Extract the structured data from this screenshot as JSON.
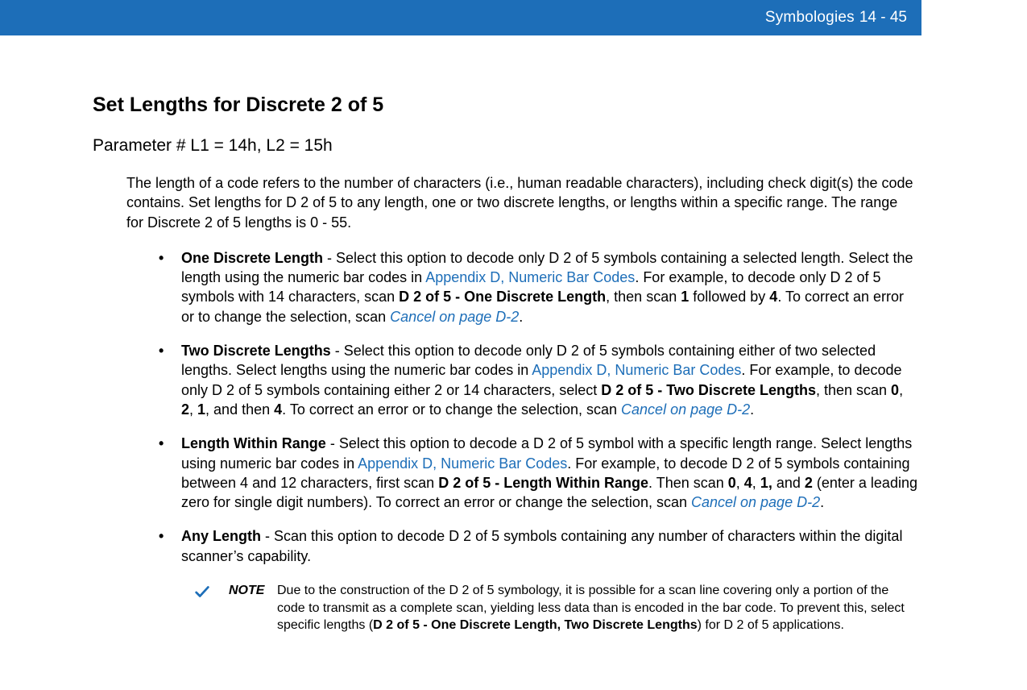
{
  "header": {
    "chapter": "Symbologies",
    "page": "14 - 45"
  },
  "title": "Set Lengths for Discrete 2 of 5",
  "param_line": "Parameter # L1 = 14h, L2 = 15h",
  "intro": "The length of a code refers to the number of characters (i.e., human readable characters), including check digit(s) the code contains. Set lengths for D 2 of 5 to any length, one or two discrete lengths, or lengths within a specific range. The range for Discrete 2 of 5 lengths is 0 - 55.",
  "items": {
    "one": {
      "name": "One Discrete Length",
      "t1": " - Select this option to decode only D 2 of 5 symbols containing a selected length. Select the length using the numeric bar codes in ",
      "link1": "Appendix D, Numeric Bar Codes",
      "t2": ". For example, to decode only D 2 of 5 symbols with 14 characters, scan ",
      "b1": "D 2 of 5 - One Discrete Length",
      "t3": ", then scan ",
      "b2": "1",
      "t4": " followed by ",
      "b3": "4",
      "t5": ". To correct an error or to change the selection, scan ",
      "link2": "Cancel on page D-2",
      "t6": "."
    },
    "two": {
      "name": "Two Discrete Lengths",
      "t1": " - Select this option to decode only D 2 of 5 symbols containing either of two selected lengths. Select lengths using the numeric bar codes in ",
      "link1": "Appendix D, Numeric Bar Codes",
      "t2": ". For example, to decode only D 2 of 5 symbols containing either 2 or 14 characters, select ",
      "b1": "D 2 of 5 - Two Discrete Lengths",
      "t3": ", then scan ",
      "b2": "0",
      "t4": ", ",
      "b3": "2",
      "t5": ", ",
      "b4": "1",
      "t6": ", and then ",
      "b5": "4",
      "t7": ". To correct an error or to change the selection, scan ",
      "link2": "Cancel on page D-2",
      "t8": "."
    },
    "range": {
      "name": "Length Within Range",
      "t1": " - Select this option to decode a D 2 of 5 symbol with a specific length range. Select lengths using numeric bar codes in ",
      "link1": "Appendix D, Numeric Bar Codes",
      "t2": ". For example, to decode D 2 of 5 symbols containing between 4 and 12 characters, first scan ",
      "b1": "D 2 of 5 - Length Within Range",
      "t3": ". Then scan ",
      "b2": "0",
      "t4": ", ",
      "b3": "4",
      "t5": ", ",
      "b4": "1,",
      "t6": " and ",
      "b5": "2",
      "t7": " (enter a leading zero for single digit numbers). To correct an error or change the selection, scan ",
      "link2": "Cancel on page D-2",
      "t8": "."
    },
    "any": {
      "name": "Any Length",
      "t1": " - Scan this option to decode D 2 of 5 symbols containing any number of characters within the digital scanner’s capability."
    }
  },
  "note": {
    "label": "NOTE",
    "t1": "Due to the construction of the D 2 of 5 symbology, it is possible for a scan line covering only a portion of the code to transmit as a complete scan, yielding less data than is encoded in the bar code. To prevent this, select specific lengths (",
    "b1": "D 2 of 5 - One Discrete Length, Two Discrete Lengths",
    "t2": ") for D 2 of 5 applications."
  }
}
